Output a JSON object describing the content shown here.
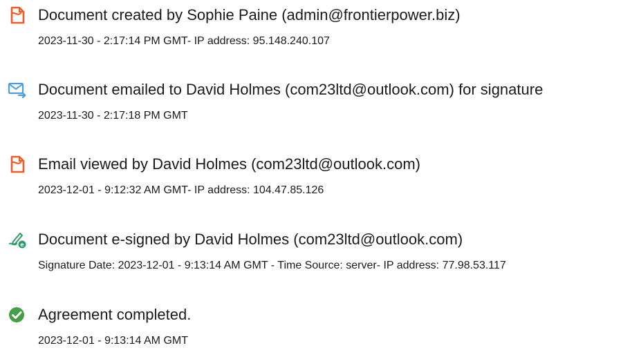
{
  "colors": {
    "accent_orange": "#F05A28",
    "email_blue": "#4A9DE0",
    "sign_green": "#2E9C6A",
    "complete_green": "#43A047"
  },
  "events": [
    {
      "icon": "document-icon",
      "title": "Document created by Sophie Paine (admin@frontierpower.biz)",
      "detail": "2023-11-30 - 2:17:14 PM GMT- IP address: 95.148.240.107"
    },
    {
      "icon": "email-send-icon",
      "title": "Document emailed to David Holmes (com23ltd@outlook.com) for signature",
      "detail": "2023-11-30 - 2:17:18 PM GMT"
    },
    {
      "icon": "document-icon",
      "title": "Email viewed by David Holmes (com23ltd@outlook.com)",
      "detail": "2023-12-01 - 9:12:32 AM GMT- IP address: 104.47.85.126"
    },
    {
      "icon": "e-sign-pen-icon",
      "title": "Document e-signed by David Holmes (com23ltd@outlook.com)",
      "detail": "Signature Date: 2023-12-01 - 9:13:14 AM GMT - Time Source: server- IP address: 77.98.53.117"
    },
    {
      "icon": "checkmark-circle-icon",
      "title": "Agreement completed.",
      "detail": "2023-12-01 - 9:13:14 AM GMT"
    }
  ]
}
